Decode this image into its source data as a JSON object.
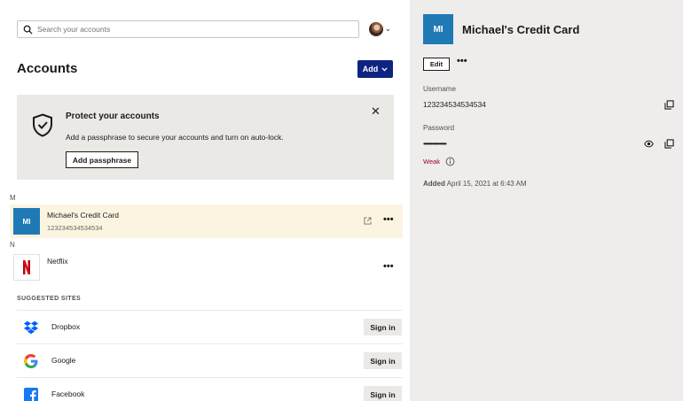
{
  "search": {
    "placeholder": "Search your accounts"
  },
  "header": {
    "title": "Accounts",
    "add_label": "Add"
  },
  "banner": {
    "title": "Protect your accounts",
    "text": "Add a passphrase to secure your accounts and turn on auto-lock.",
    "button_label": "Add passphrase"
  },
  "groups": [
    {
      "letter": "M",
      "accounts": [
        {
          "initials": "MI",
          "name": "Michael's Credit Card",
          "subtitle": "123234534534534",
          "selected": true
        }
      ]
    },
    {
      "letter": "N",
      "accounts": [
        {
          "initials": "N",
          "name": "Netflix",
          "subtitle": "",
          "selected": false
        }
      ]
    }
  ],
  "suggested": {
    "title": "SUGGESTED SITES",
    "sign_in_label": "Sign in",
    "sites": [
      {
        "name": "Dropbox",
        "icon": "dropbox-icon"
      },
      {
        "name": "Google",
        "icon": "google-icon"
      },
      {
        "name": "Facebook",
        "icon": "facebook-icon"
      }
    ]
  },
  "detail": {
    "initials": "MI",
    "title": "Michael's Credit Card",
    "edit_label": "Edit",
    "username_label": "Username",
    "username_value": "123234534534534",
    "password_label": "Password",
    "password_mask": "••••••••••••••••",
    "strength": "Weak",
    "added_label": "Added",
    "added_value": "April 15, 2021 at 6:43 AM"
  },
  "colors": {
    "accent": "#0d2481",
    "tile_blue": "#1f79b5",
    "selected_row": "#fbf4e1",
    "banner_bg": "#ebe9e6",
    "detail_bg": "#eeedeb",
    "weak": "#9b0032",
    "netflix_red": "#e50914"
  }
}
